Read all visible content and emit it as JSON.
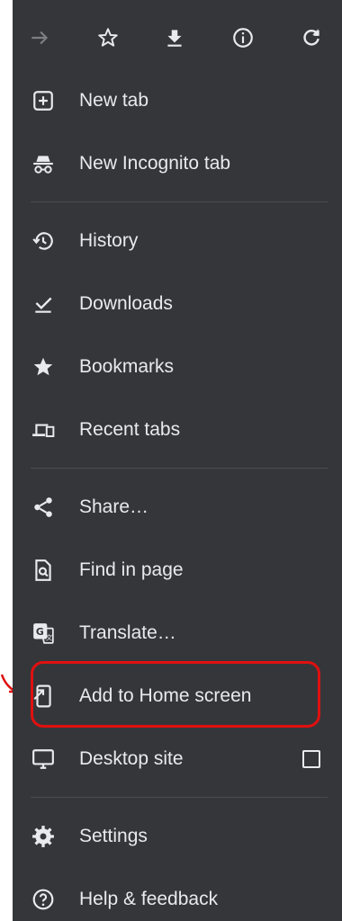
{
  "toolbar": {
    "forward": "forward-icon",
    "bookmark": "star-outline-icon",
    "download": "download-icon",
    "info": "info-icon",
    "reload": "refresh-icon"
  },
  "menu": {
    "items": [
      {
        "label": "New tab",
        "icon": "plus-box-icon"
      },
      {
        "label": "New Incognito tab",
        "icon": "incognito-icon"
      },
      {
        "label": "History",
        "icon": "history-icon"
      },
      {
        "label": "Downloads",
        "icon": "downloads-icon"
      },
      {
        "label": "Bookmarks",
        "icon": "star-icon"
      },
      {
        "label": "Recent tabs",
        "icon": "devices-icon"
      },
      {
        "label": "Share…",
        "icon": "share-icon"
      },
      {
        "label": "Find in page",
        "icon": "find-in-page-icon"
      },
      {
        "label": "Translate…",
        "icon": "translate-icon"
      },
      {
        "label": "Add to Home screen",
        "icon": "add-to-home-icon"
      },
      {
        "label": "Desktop site",
        "icon": "desktop-icon",
        "checked": false
      },
      {
        "label": "Settings",
        "icon": "gear-icon"
      },
      {
        "label": "Help & feedback",
        "icon": "help-icon"
      }
    ]
  },
  "colors": {
    "menu_bg": "#35363a",
    "text": "#e8eaed",
    "highlight": "#e01010"
  }
}
